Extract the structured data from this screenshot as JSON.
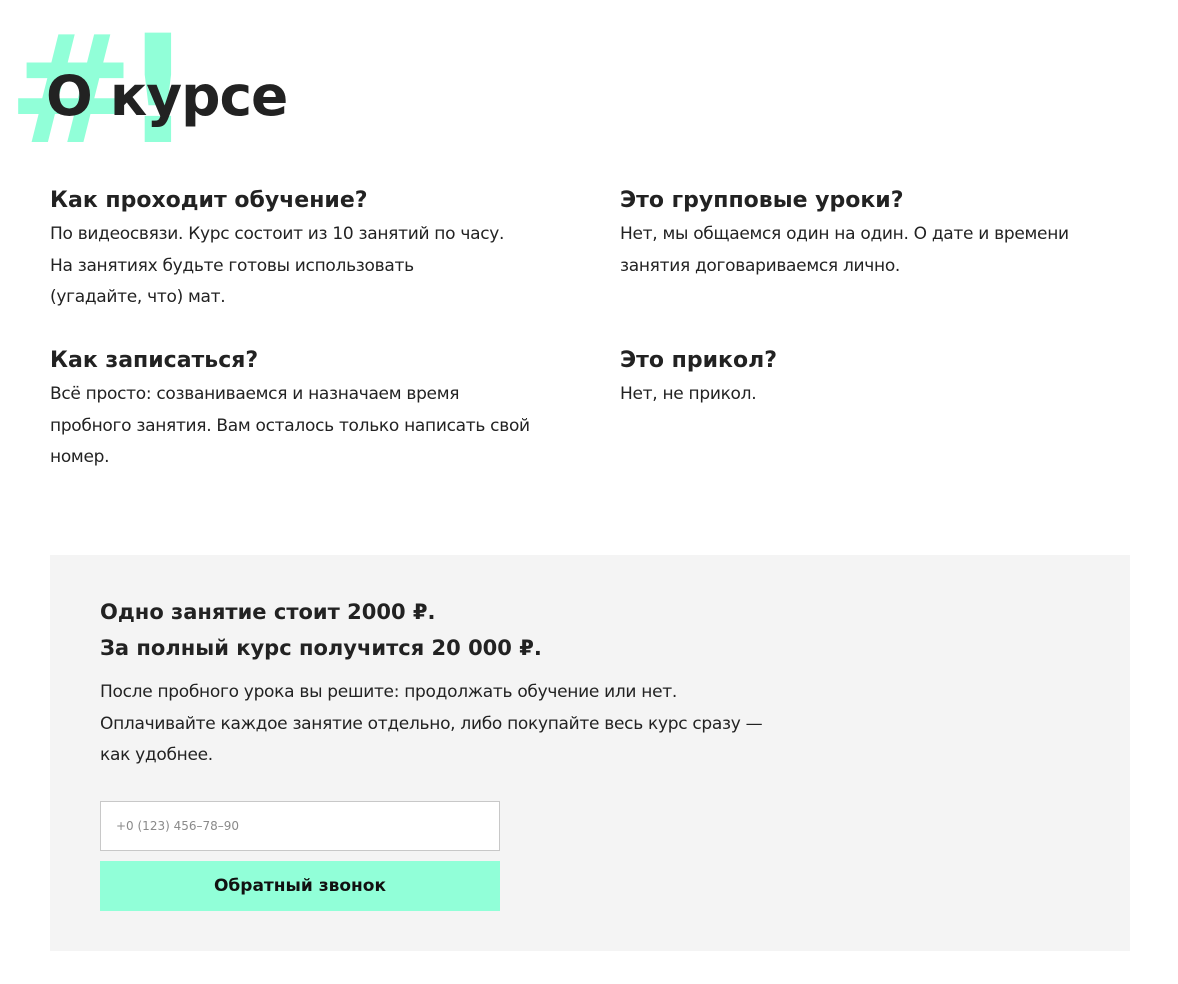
{
  "header": {
    "decoration": "#!",
    "title": "О курсе"
  },
  "faq": [
    {
      "question": "Как проходит обучение?",
      "answer_lines": [
        "По видеосвязи. Курс состоит из 10 занятий по часу.",
        "На занятиях будьте готовы использовать",
        "(угадайте, что) мат."
      ]
    },
    {
      "question": "Это групповые уроки?",
      "answer_lines": [
        "Нет, мы общаемся один на один. О дате и времени",
        "занятия договариваемся лично."
      ]
    },
    {
      "question": "Как записаться?",
      "answer_lines": [
        "Всё просто: созваниваемся и назначаем время",
        "пробного занятия. Вам осталось только написать свой",
        "номер."
      ]
    },
    {
      "question": "Это прикол?",
      "answer_lines": [
        "Нет, не прикол."
      ]
    }
  ],
  "pricing": {
    "line_1": "Одно занятие стоит 2000 ₽.",
    "line_2": "За полный курс получится 20 000 ₽.",
    "note_lines": [
      "После пробного урока вы решите: продолжать обучение или нет.",
      "Оплачивайте каждое занятие отдельно, либо покупайте весь курс сразу —",
      "как удобнее."
    ],
    "phone_placeholder": "+0 (123) 456–78–90",
    "phone_value": "",
    "button_label": "Обратный звонок"
  },
  "colors": {
    "accent": "#91ffd8",
    "text": "#222222",
    "panel_background": "#f4f4f4"
  }
}
